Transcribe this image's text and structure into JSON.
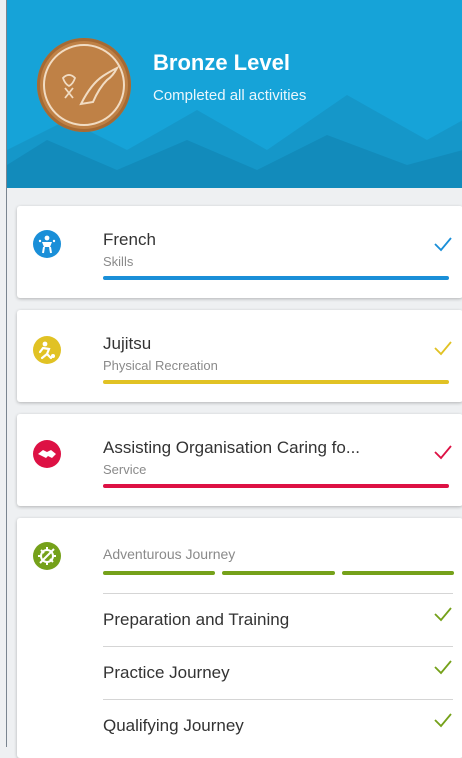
{
  "header": {
    "title": "Bronze Level",
    "subtitle": "Completed all activities",
    "badge_icon": "bronze-award-icon",
    "background": "#16a3d8",
    "badge_color": "#bf8146"
  },
  "sections": [
    {
      "title": "French",
      "category": "Skills",
      "color": "#1a8fd8",
      "icon": "skills-icon",
      "status": "completed"
    },
    {
      "title": "Jujitsu",
      "category": "Physical Recreation",
      "color": "#e1c224",
      "icon": "physical-recreation-icon",
      "status": "completed"
    },
    {
      "title": "Assisting Organisation Caring fo...",
      "category": "Service",
      "color": "#dd1144",
      "icon": "service-icon",
      "status": "completed"
    }
  ],
  "journey": {
    "category": "Adventurous Journey",
    "color": "#75a11a",
    "icon": "adventurous-journey-icon",
    "items": [
      {
        "label": "Preparation and Training",
        "status": "completed"
      },
      {
        "label": "Practice Journey",
        "status": "completed"
      },
      {
        "label": "Qualifying Journey",
        "status": "completed"
      }
    ]
  }
}
